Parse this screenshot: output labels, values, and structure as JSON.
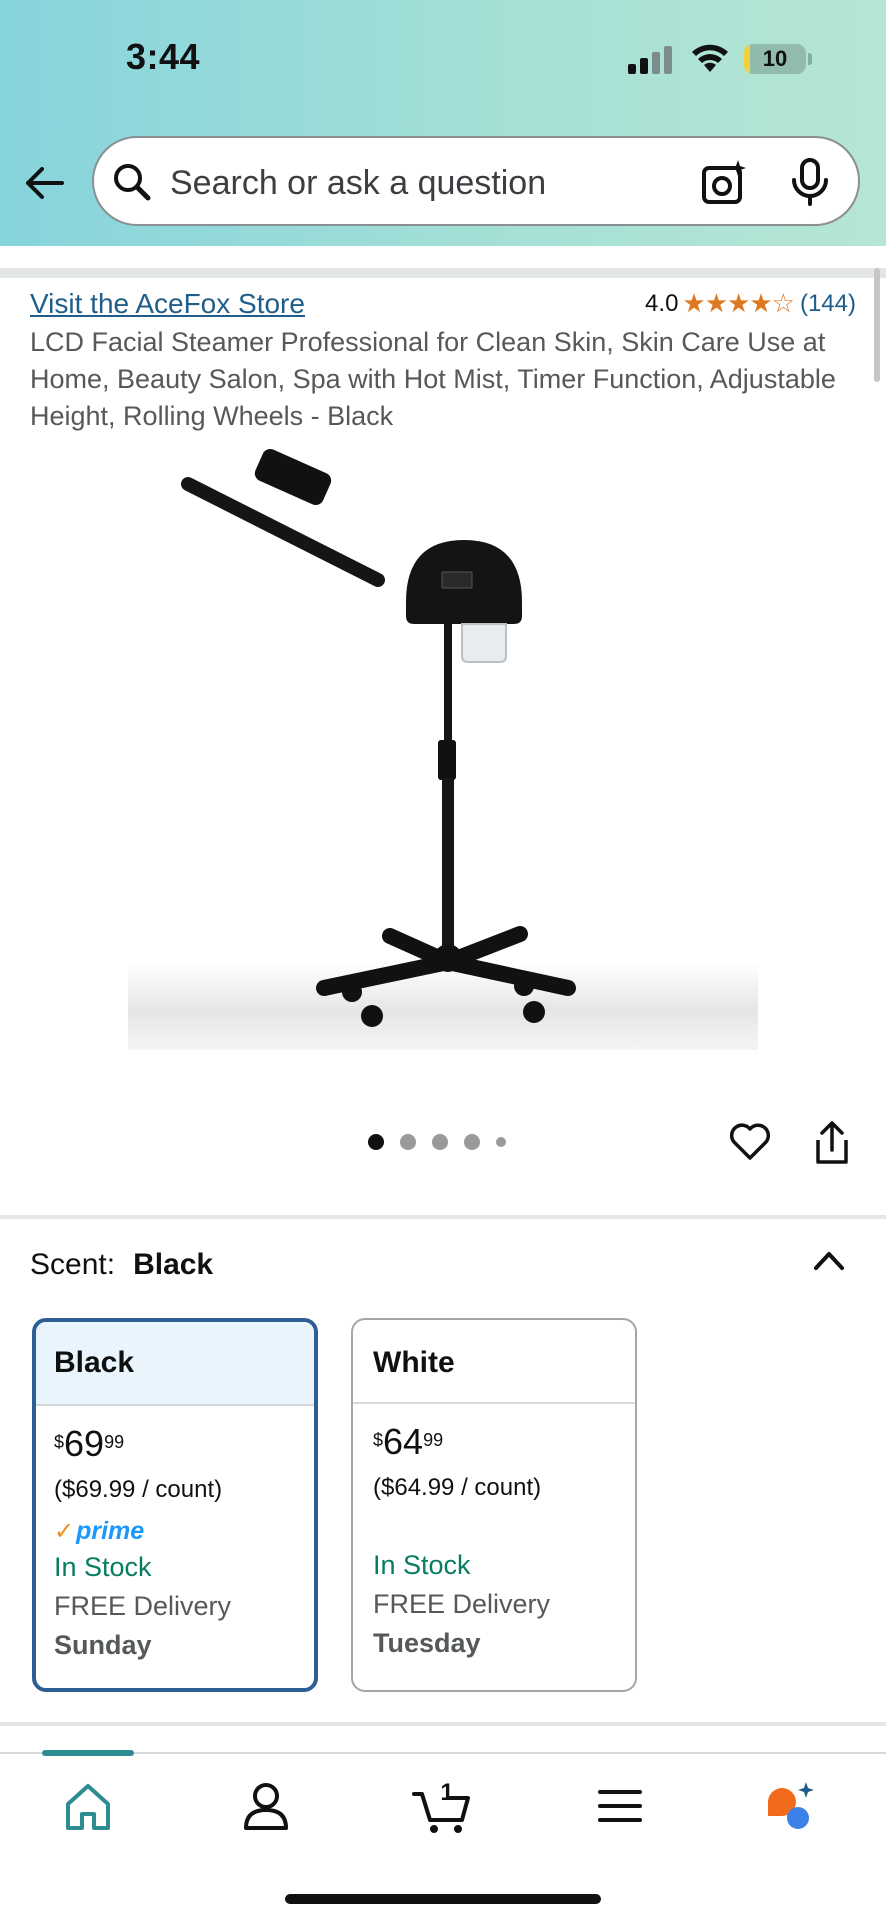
{
  "status_bar": {
    "time": "3:44",
    "battery": "10",
    "battery_level": 0.1
  },
  "search": {
    "placeholder": "Search or ask a question"
  },
  "product": {
    "store_link": "Visit the AceFox Store",
    "rating_value": "4.0",
    "rating_stars": "★★★★☆",
    "rating_count": "(144)",
    "title": "LCD Facial Steamer Professional for Clean Skin, Skin Care Use at Home, Beauty Salon, Spa with Hot Mist, Timer Function, Adjustable Height, Rolling Wheels - Black",
    "image_count": 5,
    "current_image": 1
  },
  "variant": {
    "label": "Scent:",
    "selected": "Black",
    "options": [
      {
        "name": "Black",
        "currency": "$",
        "price_whole": "69",
        "price_fraction": "99",
        "unit_price": "($69.99 / count)",
        "prime": "prime",
        "stock": "In Stock",
        "delivery": "FREE Delivery",
        "delivery_day": "Sunday",
        "selected": true
      },
      {
        "name": "White",
        "currency": "$",
        "price_whole": "64",
        "price_fraction": "99",
        "unit_price": "($64.99 / count)",
        "prime": "",
        "stock": "In Stock",
        "delivery": "FREE Delivery",
        "delivery_day": "Tuesday",
        "selected": false
      }
    ]
  },
  "bottom_nav": {
    "items": [
      "home-icon",
      "account-icon",
      "cart-icon",
      "menu-icon",
      "rufus-assistant-icon"
    ],
    "active": "home-icon",
    "cart_count": "1"
  },
  "colors": {
    "link": "#1f5e8a",
    "star": "#de7921",
    "in_stock": "#067d62",
    "selected_border": "#2e5f94",
    "nav_accent": "#2d8b92"
  }
}
